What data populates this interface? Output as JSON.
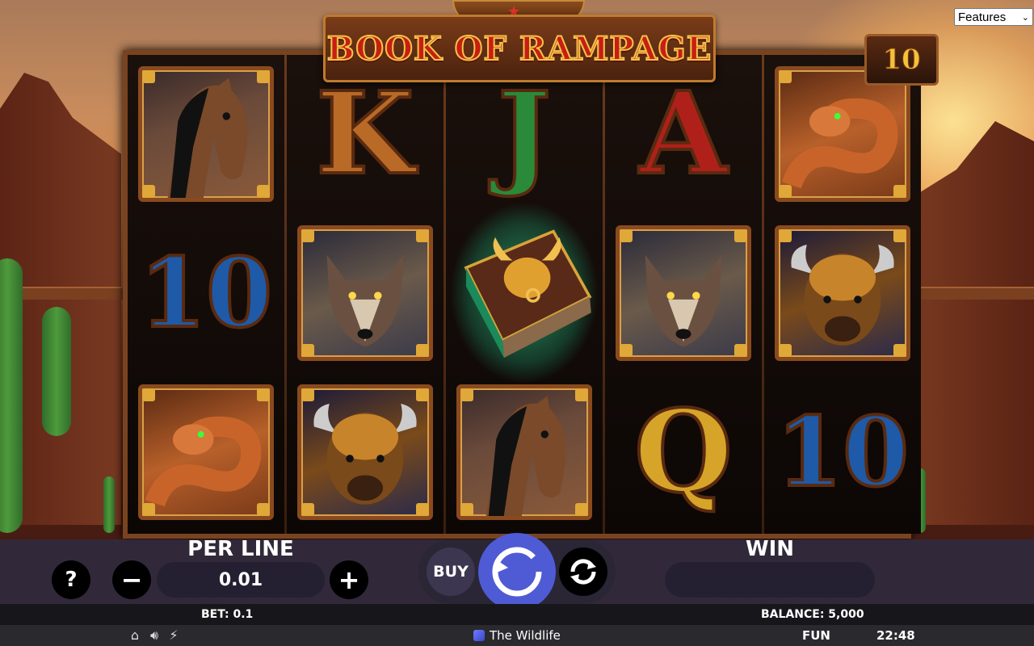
{
  "game": {
    "title": "BOOK OF RAMPAGE",
    "lines_count": "10"
  },
  "features_select": {
    "selected": "Features"
  },
  "reels": [
    [
      "horse",
      "ten",
      "snake"
    ],
    [
      "king",
      "wolf",
      "buffalo"
    ],
    [
      "jack",
      "book",
      "horse"
    ],
    [
      "ace",
      "wolf",
      "queen"
    ],
    [
      "snake",
      "buffalo",
      "ten"
    ]
  ],
  "letters": {
    "king": "K",
    "jack": "J",
    "ace": "A",
    "queen": "Q",
    "ten": "10"
  },
  "letter_colors": {
    "king": "#b86a26",
    "jack": "#2a8a3a",
    "ace": "#b0201a",
    "queen": "#d6a428",
    "ten": "#1e5aa8"
  },
  "controls": {
    "help_label": "?",
    "minus_label": "−",
    "plus_label": "+",
    "per_line_label": "PER LINE",
    "per_line_value": "0.01",
    "buy_label": "BUY",
    "win_label": "WIN",
    "win_value": ""
  },
  "info": {
    "bet": "BET: 0.1",
    "balance": "BALANCE: 5,000"
  },
  "status": {
    "studio": "The Wildlife",
    "mode": "FUN",
    "clock": "22:48"
  }
}
